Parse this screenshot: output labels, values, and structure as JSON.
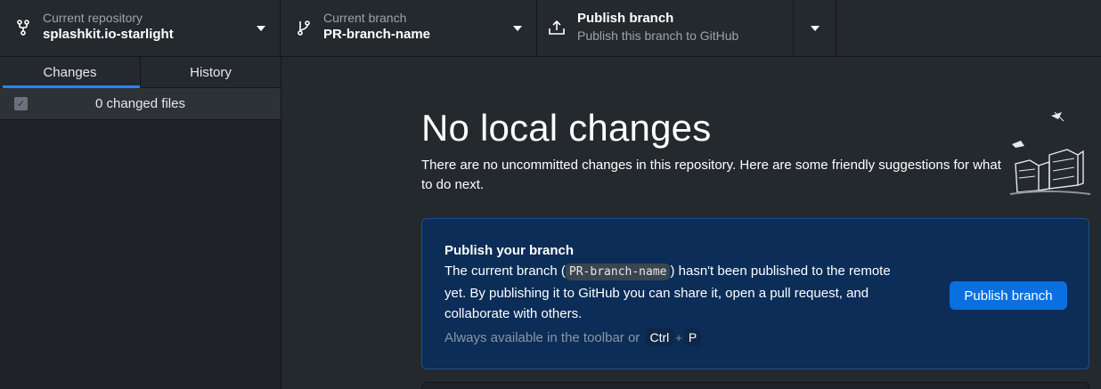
{
  "toolbar": {
    "repository": {
      "label": "Current repository",
      "value": "splashkit.io-starlight",
      "icon": "repo-fork-icon"
    },
    "branch": {
      "label": "Current branch",
      "value": "PR-branch-name",
      "icon": "git-branch-icon"
    },
    "publish": {
      "title": "Publish branch",
      "subtitle": "Publish this branch to GitHub",
      "icon": "upload-icon"
    }
  },
  "sidebar": {
    "tabs": [
      {
        "label": "Changes",
        "active": true
      },
      {
        "label": "History",
        "active": false
      }
    ],
    "changes_count": "0 changed files"
  },
  "main": {
    "title": "No local changes",
    "subtitle": "There are no uncommitted changes in this repository. Here are some friendly suggestions for what to do next.",
    "card": {
      "title": "Publish your branch",
      "body_prefix": "The current branch (",
      "branch_code": "PR-branch-name",
      "body_suffix": ") hasn't been published to the remote yet. By publishing it to GitHub you can share it, open a pull request, and collaborate with others.",
      "hint": "Always available in the toolbar or",
      "shortcut_key1": "Ctrl",
      "shortcut_plus": "+",
      "shortcut_key2": "P",
      "button_label": "Publish branch"
    }
  },
  "colors": {
    "accent": "#2f81f7",
    "card_bg": "#0b2d57",
    "button": "#0a6fe0"
  }
}
